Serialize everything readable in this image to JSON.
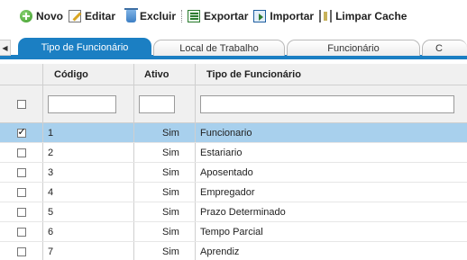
{
  "toolbar": {
    "novo": "Novo",
    "editar": "Editar",
    "excluir": "Excluir",
    "exportar": "Exportar",
    "importar": "Importar",
    "limpar_cache": "Limpar Cache"
  },
  "tabs": [
    {
      "label": "Tipo de Funcionário",
      "active": true
    },
    {
      "label": "Local de Trabalho",
      "active": false
    },
    {
      "label": "Funcionário",
      "active": false
    },
    {
      "label": "C",
      "active": false
    }
  ],
  "tab_scroll_left": "◀",
  "grid": {
    "columns": [
      "Código",
      "Ativo",
      "Tipo de Funcionário"
    ],
    "filters": {
      "codigo": "",
      "ativo": "",
      "tipo": ""
    },
    "rows": [
      {
        "codigo": "1",
        "ativo": "Sim",
        "tipo": "Funcionario",
        "checked": true
      },
      {
        "codigo": "2",
        "ativo": "Sim",
        "tipo": "Estariario",
        "checked": false
      },
      {
        "codigo": "3",
        "ativo": "Sim",
        "tipo": "Aposentado",
        "checked": false
      },
      {
        "codigo": "4",
        "ativo": "Sim",
        "tipo": "Empregador",
        "checked": false
      },
      {
        "codigo": "5",
        "ativo": "Sim",
        "tipo": "Prazo Determinado",
        "checked": false
      },
      {
        "codigo": "6",
        "ativo": "Sim",
        "tipo": "Tempo Parcial",
        "checked": false
      },
      {
        "codigo": "7",
        "ativo": "Sim",
        "tipo": "Aprendiz",
        "checked": false
      }
    ]
  },
  "colors": {
    "accent": "#1b7fc3",
    "selected_row": "#a8d0ed",
    "header_bg": "#f0f0f0"
  },
  "icons": [
    "plus-circle-icon",
    "edit-icon",
    "trash-icon",
    "excel-export-icon",
    "import-icon",
    "clear-cache-icon"
  ]
}
